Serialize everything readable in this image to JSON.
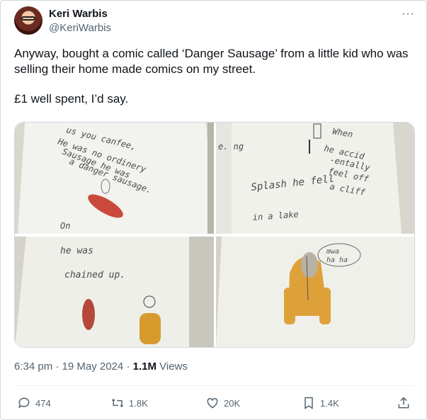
{
  "author": {
    "name": "Keri Warbis",
    "handle": "@KeriWarbis"
  },
  "more_label": "···",
  "tweet": {
    "line1": "Anyway, bought a comic called ‘Danger Sausage’ from a little kid who was selling their home made comics on my street.",
    "line2": "£1 well spent, I’d say."
  },
  "media": {
    "panel1": {
      "lines": [
        "us    you canfee,",
        "He was    no ordinery",
        "Sausage   he was",
        "a danger sausage."
      ],
      "extra": "On"
    },
    "panel2": {
      "lines": [
        "When",
        "he accid",
        "-entally",
        "feel off",
        "a cliff",
        "Splash   he fell",
        "in a lake"
      ],
      "margin": "e.  ng"
    },
    "panel3": {
      "lines": [
        "he    was",
        "chained    up."
      ]
    },
    "panel4": {
      "bubble_lines": [
        "mwa",
        "ha ha"
      ]
    }
  },
  "meta": {
    "time": "6:34 pm",
    "date": "19 May 2024",
    "views_count": "1.1M",
    "views_label": "Views",
    "sep": "·"
  },
  "actions": {
    "replies": "474",
    "reposts": "1.8K",
    "likes": "20K",
    "bookmarks": "1.4K"
  }
}
